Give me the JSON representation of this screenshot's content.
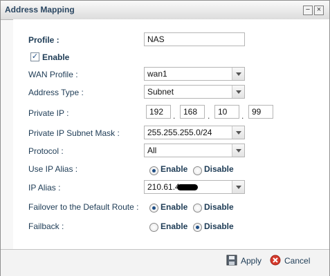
{
  "window": {
    "title": "Address Mapping"
  },
  "form": {
    "profile": {
      "label": "Profile :",
      "value": "NAS"
    },
    "enable": {
      "label": "Enable",
      "checked": true
    },
    "wan_profile": {
      "label": "WAN Profile :",
      "value": "wan1"
    },
    "address_type": {
      "label": "Address Type :",
      "value": "Subnet"
    },
    "private_ip": {
      "label": "Private IP :",
      "octets": [
        "192",
        "168",
        "10",
        "99"
      ]
    },
    "subnet_mask": {
      "label": "Private IP Subnet Mask :",
      "value": "255.255.255.0/24"
    },
    "protocol": {
      "label": "Protocol :",
      "value": "All"
    },
    "use_ip_alias": {
      "label": "Use IP Alias :",
      "enable_label": "Enable",
      "disable_label": "Disable",
      "selected": "Enable"
    },
    "ip_alias": {
      "label": "IP Alias :",
      "value": "210.61.4"
    },
    "failover": {
      "label": "Failover to the Default Route :",
      "enable_label": "Enable",
      "disable_label": "Disable",
      "selected": "Enable"
    },
    "failback": {
      "label": "Failback :",
      "enable_label": "Enable",
      "disable_label": "Disable",
      "selected": "Disable"
    }
  },
  "footer": {
    "apply_label": "Apply",
    "cancel_label": "Cancel"
  },
  "colors": {
    "label_text": "#1d3b55",
    "radio_selected": "#1f4e85",
    "cancel_icon": "#d63a2c"
  }
}
